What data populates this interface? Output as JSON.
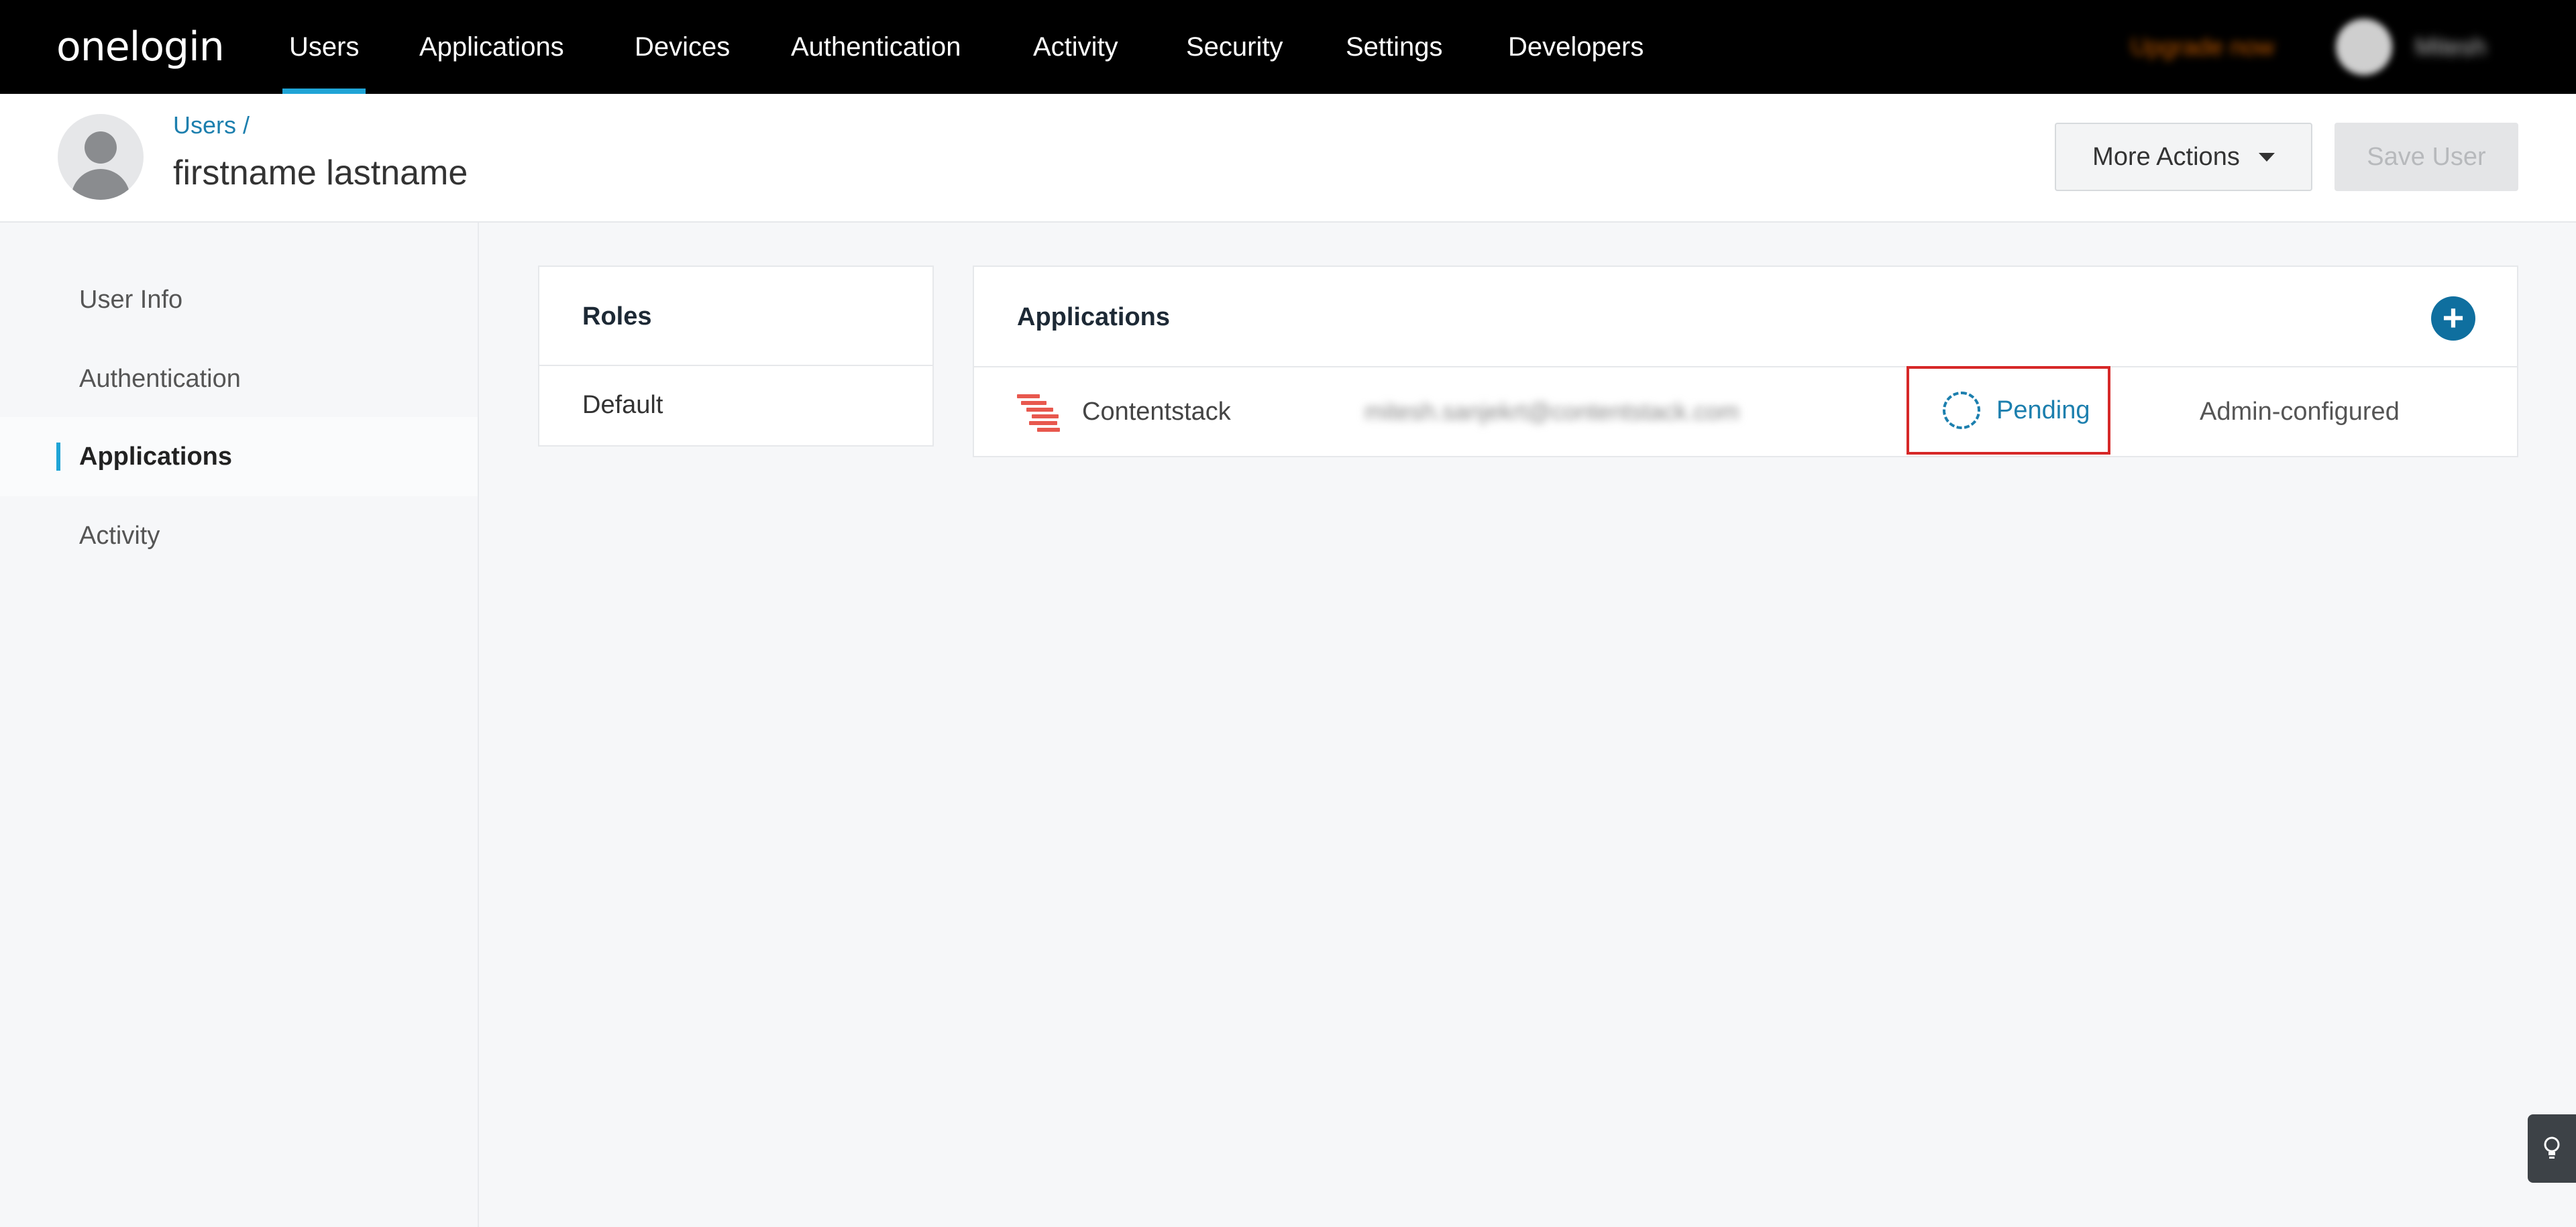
{
  "brand": {
    "logo": "onelogin"
  },
  "topnav": {
    "items": [
      {
        "label": "Users",
        "active": true
      },
      {
        "label": "Applications"
      },
      {
        "label": "Devices"
      },
      {
        "label": "Authentication"
      },
      {
        "label": "Activity"
      },
      {
        "label": "Security"
      },
      {
        "label": "Settings"
      },
      {
        "label": "Developers"
      }
    ],
    "upgrade_label": "Upgrade now",
    "account_name": "Mitesh"
  },
  "header": {
    "breadcrumb": "Users /",
    "title": "firstname lastname",
    "more_actions_label": "More Actions",
    "save_label": "Save User"
  },
  "sidebar": {
    "items": [
      {
        "label": "User Info"
      },
      {
        "label": "Authentication"
      },
      {
        "label": "Applications",
        "active": true
      },
      {
        "label": "Activity"
      }
    ]
  },
  "roles": {
    "heading": "Roles",
    "items": [
      "Default"
    ]
  },
  "applications": {
    "heading": "Applications",
    "add_symbol": "+",
    "rows": [
      {
        "name": "Contentstack",
        "login": "mitesh.sanjekrt@contentstack.com",
        "status": "Pending",
        "type": "Admin-configured"
      }
    ]
  },
  "colors": {
    "accent": "#1fa4d6",
    "link": "#1c7fae",
    "highlight_box": "#d62828",
    "add_button": "#0f6f9f"
  }
}
